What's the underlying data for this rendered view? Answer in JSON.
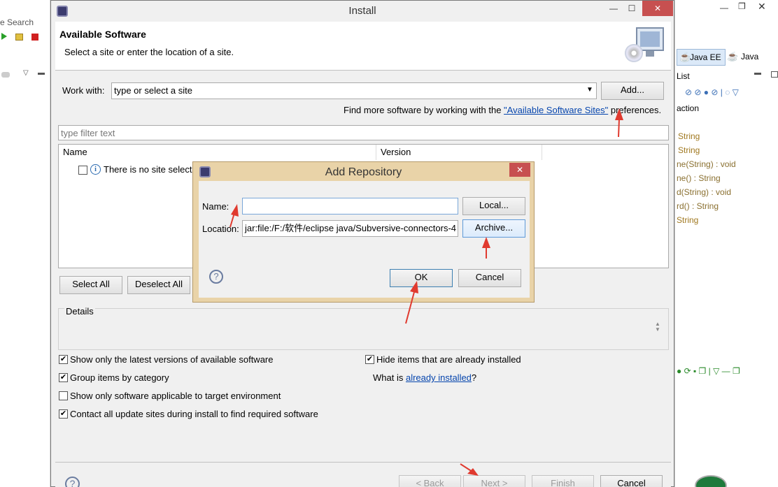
{
  "background": {
    "left_menu": "e Search",
    "right_tabs": [
      "Java EE",
      "Java"
    ],
    "right_panel_title": "List",
    "outline_items": [
      "action",
      "String",
      "String",
      "ne(String) : void",
      "ne() : String",
      "d(String) : void",
      "rd() : String",
      "String"
    ]
  },
  "install": {
    "title": "Install",
    "header_title": "Available Software",
    "header_subtitle": "Select a site or enter the location of a site.",
    "work_with_label": "Work with:",
    "work_with_value": "type or select a site",
    "add_button": "Add...",
    "find_more_prefix": "Find more software by working with the ",
    "find_more_link": "\"Available Software Sites\"",
    "find_more_suffix": " preferences.",
    "filter_placeholder": "type filter text",
    "table_headers": [
      "Name",
      "Version"
    ],
    "table_row": "There is no site select",
    "select_all": "Select All",
    "deselect_all": "Deselect All",
    "details_label": "Details",
    "options": [
      {
        "label": "Show only the latest versions of available software",
        "checked": true
      },
      {
        "label": "Group items by category",
        "checked": true
      },
      {
        "label": "Show only software applicable to target environment",
        "checked": false
      },
      {
        "label": "Contact all update sites during install to find required software",
        "checked": true
      }
    ],
    "hide_installed": {
      "label": "Hide items that are already installed",
      "checked": true
    },
    "what_is_prefix": "What is ",
    "what_is_link": "already installed",
    "what_is_suffix": "?",
    "back_button": "< Back",
    "next_button": "Next >",
    "finish_button": "Finish",
    "cancel_button": "Cancel"
  },
  "repo": {
    "title": "Add Repository",
    "name_label": "Name:",
    "name_value": "",
    "local_button": "Local...",
    "location_label": "Location:",
    "location_value": "jar:file:/F:/软件/eclipse  java/Subversive-connectors-4",
    "archive_button": "Archive...",
    "ok_button": "OK",
    "cancel_button": "Cancel"
  },
  "colors": {
    "accent_red": "#e03a2f",
    "link_blue": "#0645ad",
    "dialog_frame": "#e9d3a8"
  }
}
